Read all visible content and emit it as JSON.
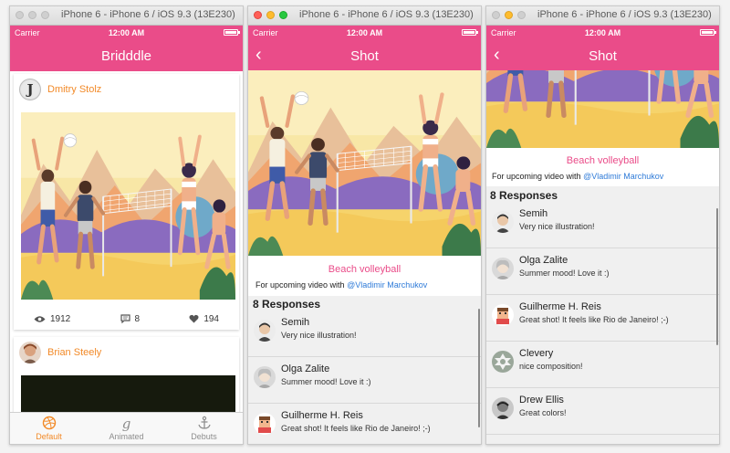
{
  "windows": [
    {
      "title": "iPhone 6 - iPhone 6 / iOS 9.3 (13E230)",
      "carrier": "Carrier",
      "time": "12:00 AM",
      "nav_title": "Bridddle",
      "posts": [
        {
          "author": "Dmitry Stolz",
          "views": "1912",
          "comments": "8",
          "likes": "194"
        },
        {
          "author": "Brian Steely"
        }
      ],
      "tabs": [
        {
          "label": "Default",
          "icon": "dribbble-ball-icon"
        },
        {
          "label": "Animated",
          "icon": "script-g-icon"
        },
        {
          "label": "Debuts",
          "icon": "anchor-icon"
        }
      ]
    },
    {
      "title": "iPhone 6 - iPhone 6 / iOS 9.3 (13E230)",
      "carrier": "Carrier",
      "time": "12:00 AM",
      "nav_title": "Shot",
      "shot_title": "Beach volleyball",
      "desc_prefix": "For upcoming video with",
      "mention": "@Vladimir Marchukov",
      "responses_header": "8 Responses",
      "responses": [
        {
          "name": "Semih",
          "text": "Very nice illustration!"
        },
        {
          "name": "Olga Zalite",
          "text": "Summer mood! Love it :)"
        },
        {
          "name": "Guilherme H. Reis",
          "text": "Great shot! It feels like Rio de Janeiro! ;-)"
        }
      ]
    },
    {
      "title": "iPhone 6 - iPhone 6 / iOS 9.3 (13E230)",
      "carrier": "Carrier",
      "time": "12:00 AM",
      "nav_title": "Shot",
      "shot_title": "Beach volleyball",
      "desc_prefix": "For upcoming video with",
      "mention": "@Vladimir Marchukov",
      "responses_header": "8 Responses",
      "responses": [
        {
          "name": "Semih",
          "text": "Very nice illustration!"
        },
        {
          "name": "Olga Zalite",
          "text": "Summer mood! Love it :)"
        },
        {
          "name": "Guilherme H. Reis",
          "text": "Great shot! It feels like Rio de Janeiro! ;-)"
        },
        {
          "name": "Clevery",
          "text": "nice composition!"
        },
        {
          "name": "Drew Ellis",
          "text": "Great colors!"
        }
      ]
    }
  ],
  "colors": {
    "brand_pink": "#ea4c89",
    "accent_orange": "#f28a28",
    "link_blue": "#2f7bd8"
  }
}
